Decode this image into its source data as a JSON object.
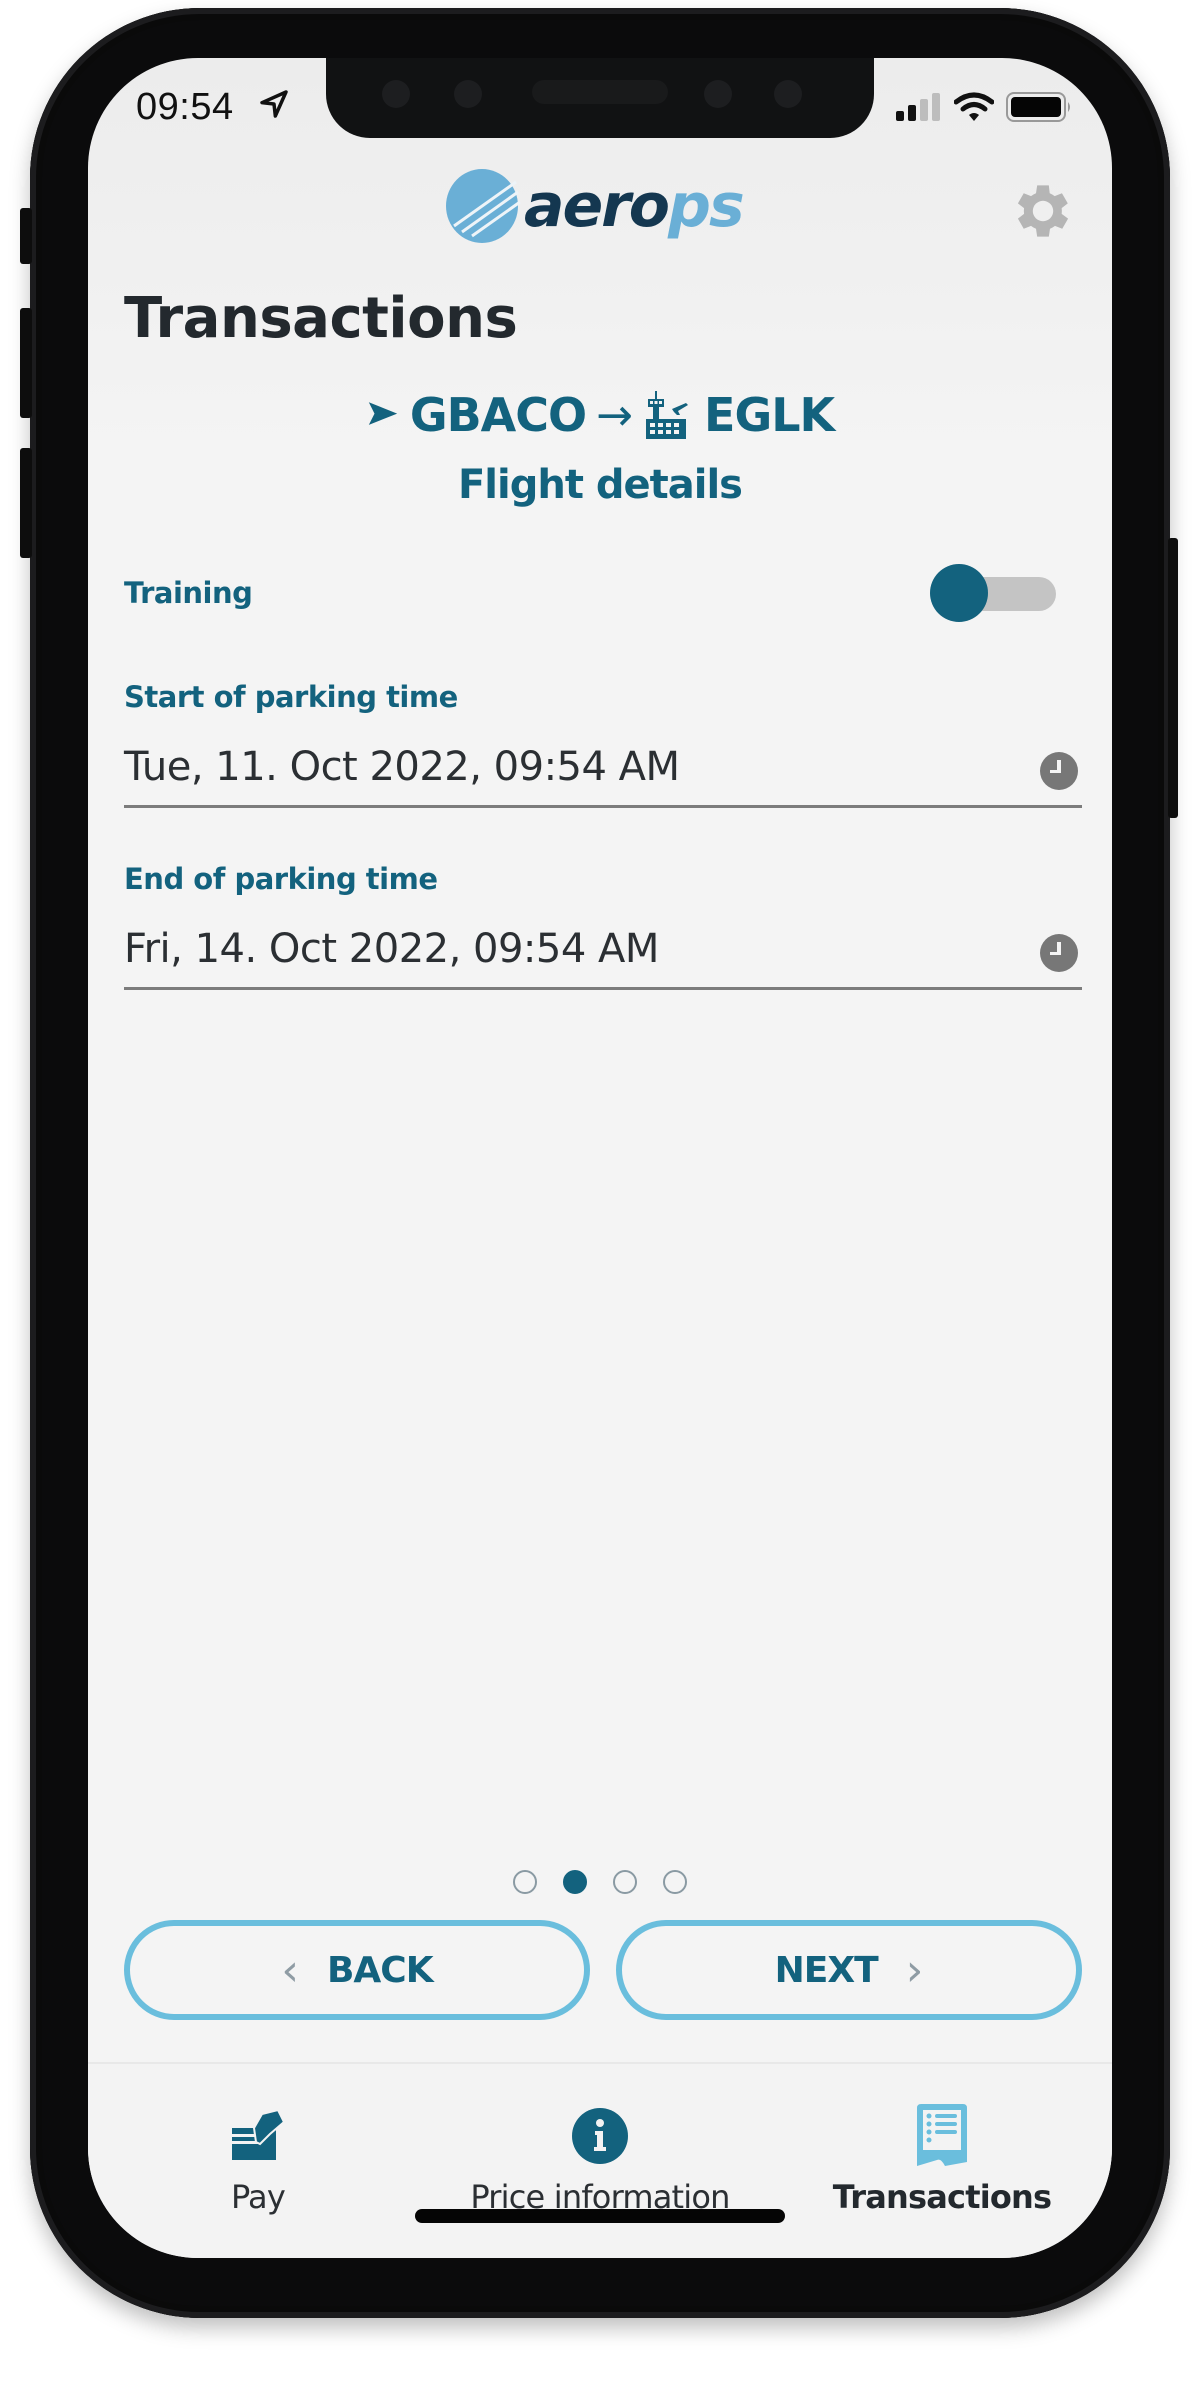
{
  "status_bar": {
    "time": "09:54",
    "location_icon": "location-arrow-icon",
    "signal_icon": "cellular-signal-icon",
    "wifi_icon": "wifi-icon",
    "battery_icon": "battery-icon"
  },
  "header": {
    "logo": {
      "part1": "aero",
      "part2": "ps"
    },
    "settings_icon": "gear-icon",
    "title": "Transactions"
  },
  "flight": {
    "origin_icon": "aircraft-arrow-icon",
    "origin": "GBACO",
    "arrow": "→",
    "destination_icon": "airport-tower-icon",
    "destination": "EGLK",
    "subtitle": "Flight details"
  },
  "form": {
    "training": {
      "label": "Training",
      "enabled": false
    },
    "start_parking": {
      "label": "Start of parking time",
      "value": "Tue, 11. Oct 2022, 09:54 AM",
      "icon": "clock-icon"
    },
    "end_parking": {
      "label": "End of parking time",
      "value": "Fri, 14. Oct 2022, 09:54 AM",
      "icon": "clock-icon"
    }
  },
  "pagination": {
    "total": 4,
    "current": 2
  },
  "buttons": {
    "back": {
      "label": "BACK",
      "icon": "chevron-left-icon"
    },
    "next": {
      "label": "NEXT",
      "icon": "chevron-right-icon"
    }
  },
  "tabs": [
    {
      "label": "Pay",
      "icon": "pay-card-icon",
      "active": false
    },
    {
      "label": "Price information",
      "icon": "info-circle-icon",
      "active": false
    },
    {
      "label": "Transactions",
      "icon": "receipt-list-icon",
      "active": true
    }
  ],
  "colors": {
    "primary": "#13627e",
    "accent_light": "#6abedd",
    "logo_dark": "#143750",
    "logo_light": "#6aafd6",
    "toggle_track": "#c4c4c4",
    "gear": "#b5b5b5"
  }
}
